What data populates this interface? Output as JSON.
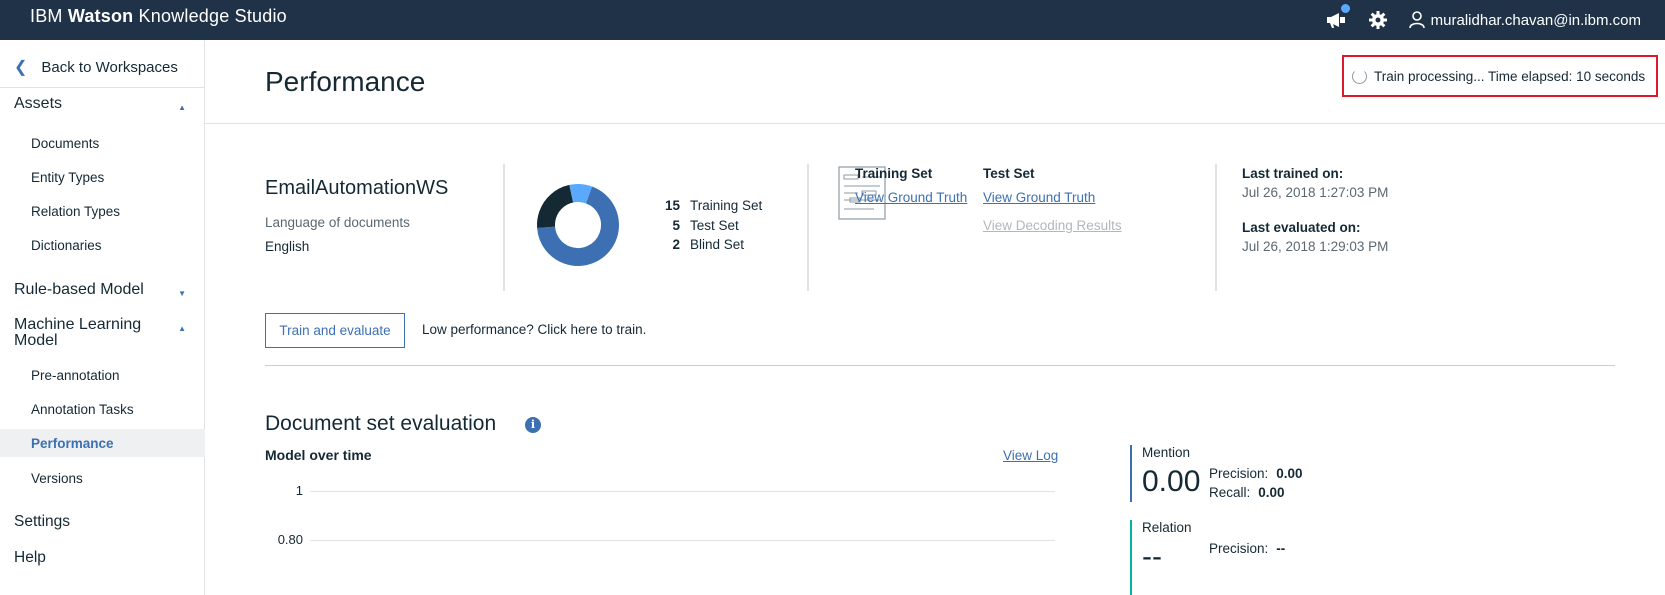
{
  "app": {
    "brand_prefix": "IBM",
    "brand_bold": "Watson",
    "brand_suffix": "Knowledge Studio",
    "user_email": "muralidhar.chavan@in.ibm.com"
  },
  "sidebar": {
    "back_label": "Back to Workspaces",
    "assets_label": "Assets",
    "assets_items": [
      "Documents",
      "Entity Types",
      "Relation Types",
      "Dictionaries"
    ],
    "rule_label": "Rule-based Model",
    "ml_label": "Machine Learning Model",
    "ml_items": [
      "Pre-annotation",
      "Annotation Tasks",
      "Performance",
      "Versions"
    ],
    "active_item": "Performance",
    "settings_label": "Settings",
    "help_label": "Help"
  },
  "page": {
    "title": "Performance",
    "status": "Train processing... Time elapsed: 10 seconds"
  },
  "workspace": {
    "name": "EmailAutomationWS",
    "language_label": "Language of documents",
    "language_value": "English"
  },
  "sets": [
    {
      "count": "15",
      "label": "Training Set",
      "color": "#3d70b2"
    },
    {
      "count": "5",
      "label": "Test Set",
      "color": "#152935"
    },
    {
      "count": "2",
      "label": "Blind Set",
      "color": "#5aa9ff"
    }
  ],
  "ground_truth": {
    "training_title": "Training Set",
    "training_link": "View Ground Truth",
    "test_title": "Test Set",
    "test_link": "View Ground Truth",
    "decoding_link": "View Decoding Results"
  },
  "trained": {
    "last_trained_label": "Last trained on:",
    "last_trained_value": "Jul 26, 2018 1:27:03 PM",
    "last_evaluated_label": "Last evaluated on:",
    "last_evaluated_value": "Jul 26, 2018 1:29:03 PM"
  },
  "actions": {
    "train_button": "Train and evaluate",
    "low_perf": "Low performance? Click here to train."
  },
  "evaluation": {
    "title": "Document set evaluation",
    "chart_title": "Model over time",
    "view_log": "View Log",
    "yticks": [
      "1",
      "0.80"
    ]
  },
  "metrics": {
    "mention": {
      "title": "Mention",
      "value": "0.00",
      "precision_label": "Precision:",
      "precision": "0.00",
      "recall_label": "Recall:",
      "recall": "0.00",
      "color": "#3d70b2"
    },
    "relation": {
      "title": "Relation",
      "value": "--",
      "precision_label": "Precision:",
      "precision": "--",
      "color": "#00b6a0"
    }
  }
}
